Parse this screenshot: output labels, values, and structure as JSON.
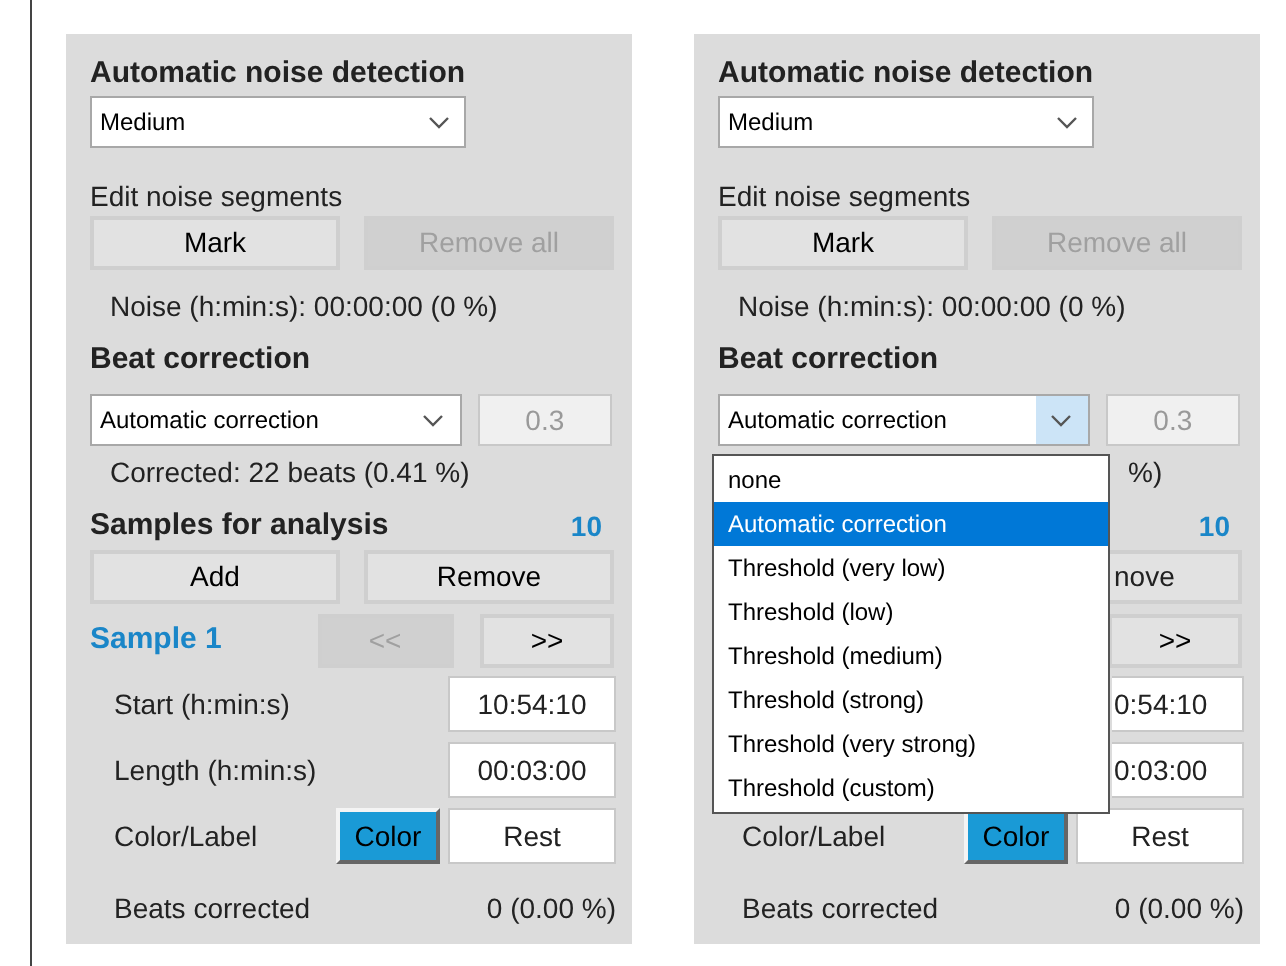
{
  "panels": [
    {
      "noise_detection": {
        "title": "Automatic noise detection",
        "select": {
          "value": "Medium",
          "open": false
        }
      },
      "noise_segments": {
        "title": "Edit noise segments",
        "buttons": [
          {
            "label": "Mark",
            "disabled": false
          },
          {
            "label": "Remove all",
            "disabled": true
          }
        ],
        "summary": "Noise (h:min:s): 00:00:00 (0 %)"
      },
      "beat_correction": {
        "title": "Beat correction",
        "select": {
          "value": "Automatic correction",
          "open": false
        },
        "value": "0.3",
        "corrected": "Corrected: 22 beats (0.41 %)"
      },
      "samples": {
        "title": "Samples for analysis",
        "count": "10",
        "buttons": [
          {
            "label": "Add",
            "disabled": false
          },
          {
            "label": "Remove",
            "disabled": false
          }
        ],
        "sample_label": "Sample 1",
        "prev": {
          "label": "<<",
          "disabled": true
        },
        "next": {
          "label": ">>",
          "disabled": false
        },
        "fields": [
          {
            "label": "Start (h:min:s)",
            "value": "10:54:10"
          },
          {
            "label": "Length (h:min:s)",
            "value": "00:03:00"
          }
        ],
        "color_label": {
          "label": "Color/Label",
          "button": "Color",
          "value": "Rest",
          "color": "#1a9ad6"
        },
        "beats_corrected": {
          "label": "Beats corrected",
          "value": "0 (0.00 %)"
        }
      }
    },
    {
      "noise_detection": {
        "title": "Automatic noise detection",
        "select": {
          "value": "Medium",
          "open": false
        }
      },
      "noise_segments": {
        "title": "Edit noise segments",
        "buttons": [
          {
            "label": "Mark",
            "disabled": false
          },
          {
            "label": "Remove all",
            "disabled": true
          }
        ],
        "summary": "Noise (h:min:s): 00:00:00 (0 %)"
      },
      "beat_correction": {
        "title": "Beat correction",
        "select": {
          "value": "Automatic correction",
          "open": true
        },
        "value": "0.3",
        "corrected_tail": "%)",
        "options": [
          {
            "label": "none",
            "selected": false
          },
          {
            "label": "Automatic correction",
            "selected": true
          },
          {
            "label": "Threshold (very low)",
            "selected": false
          },
          {
            "label": "Threshold (low)",
            "selected": false
          },
          {
            "label": "Threshold (medium)",
            "selected": false
          },
          {
            "label": "Threshold (strong)",
            "selected": false
          },
          {
            "label": "Threshold (very strong)",
            "selected": false
          },
          {
            "label": "Threshold (custom)",
            "selected": false
          }
        ]
      },
      "samples": {
        "count": "10",
        "remove_tail": "nove",
        "next": {
          "label": ">>",
          "disabled": false
        },
        "field_tails": [
          "0:54:10",
          "0:03:00"
        ],
        "color_label": {
          "label": "Color/Label",
          "button": "Color",
          "value": "Rest",
          "color": "#1a9ad6"
        },
        "beats_corrected": {
          "label": "Beats corrected",
          "value": "0 (0.00 %)"
        }
      }
    }
  ]
}
